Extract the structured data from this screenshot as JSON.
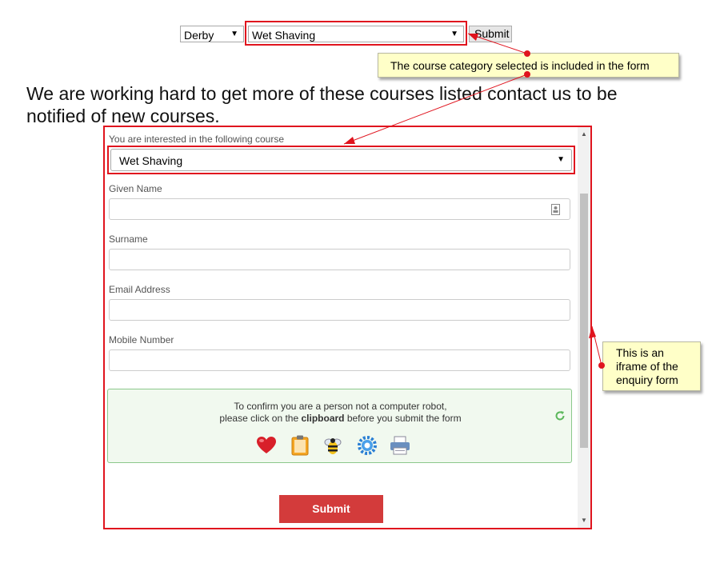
{
  "top_form": {
    "location_select": "Derby",
    "category_select": "Wet Shaving",
    "submit_label": "Submit"
  },
  "headline": "We are working hard to get more of these courses listed contact us to be notified of new courses.",
  "annotations": {
    "category_note": "The course category selected is included in the form",
    "iframe_note": "This is an iframe of the enquiry form"
  },
  "enquiry_form": {
    "course_label": "You are interested in the following course",
    "course_value": "Wet Shaving",
    "given_name_label": "Given Name",
    "surname_label": "Surname",
    "email_label": "Email Address",
    "mobile_label": "Mobile Number",
    "captcha": {
      "line1": "To confirm you are a person not a computer robot,",
      "line2_prefix": "please click on the ",
      "line2_bold": "clipboard",
      "line2_suffix": " before you submit the form",
      "icons": [
        "heart-icon",
        "clipboard-icon",
        "bee-icon",
        "gear-icon",
        "printer-icon"
      ],
      "success_color": "#5cb85c"
    },
    "submit_label": "Submit",
    "submit_color": "#d33b3b"
  },
  "colors": {
    "annotation_red": "#e0141e",
    "note_bg": "#ffffc8"
  }
}
